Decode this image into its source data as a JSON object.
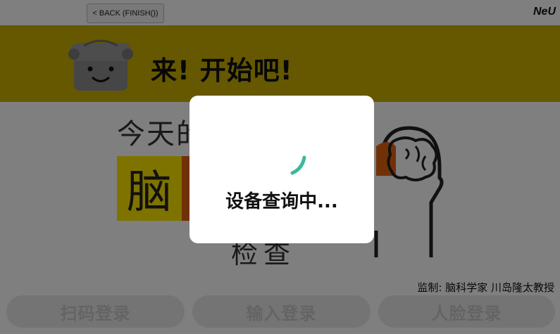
{
  "topbar": {
    "back_label": "< BACK (FINISH())",
    "brand": "NeU"
  },
  "banner": {
    "title": "来!  开始吧!"
  },
  "main": {
    "subtitle": "今天的",
    "word_char": "脑",
    "word_bottom": "检查",
    "supervisor": "监制:  脑科学家 川岛隆太教授"
  },
  "buttons": [
    {
      "label": "扫码登录"
    },
    {
      "label": "输入登录"
    },
    {
      "label": "人脸登录"
    }
  ],
  "dialog": {
    "message": "设备查询中..."
  },
  "colors": {
    "banner": "#ccb000",
    "highlight_yellow": "#ffe600",
    "highlight_orange": "#e3630f",
    "spinner": "#3db89a"
  }
}
